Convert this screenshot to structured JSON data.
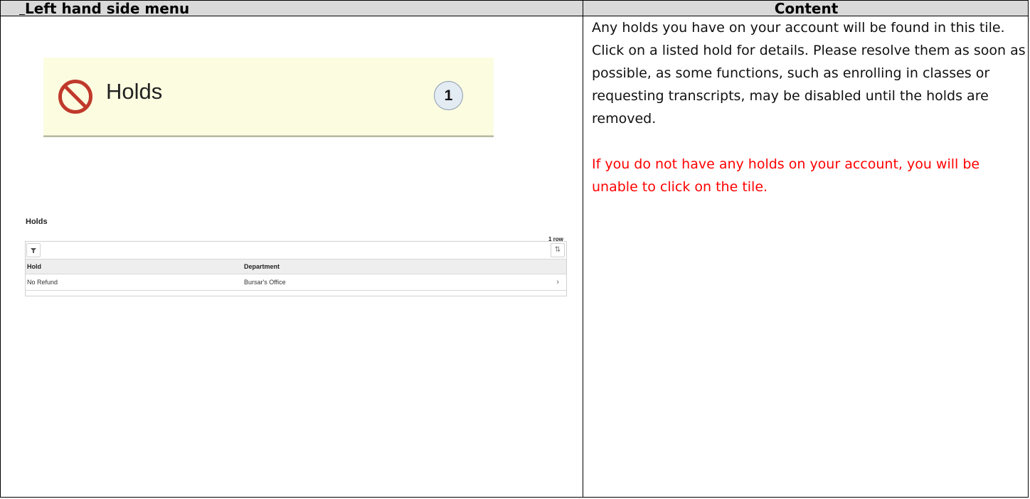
{
  "table": {
    "header_left": "Left hand side menu",
    "header_right": "Content"
  },
  "tile": {
    "icon": "no-entry-icon",
    "title": "Holds",
    "badge_count": "1",
    "colors": {
      "background": "#fcfce1",
      "icon": "#c0392b",
      "badge": "#e3ebf3"
    }
  },
  "holds_grid": {
    "title": "Holds",
    "row_count": "1 row",
    "filter_icon": "filter-icon",
    "sort_icon": "sort-icon",
    "columns": [
      "Hold",
      "Department"
    ],
    "rows": [
      {
        "hold": "No Refund",
        "department": "Bursar's Office",
        "action_icon": "chevron-right-icon"
      }
    ]
  },
  "content": {
    "paragraph": "Any holds you have on your account will be found in this tile. Click on a listed hold for details. Please resolve them as soon as possible, as some functions, such as enrolling in classes or requesting transcripts, may be disabled until the holds are removed.",
    "note": "If you do not have any holds on your account, you will be unable to click on the tile.",
    "note_color": "#ff0000"
  }
}
